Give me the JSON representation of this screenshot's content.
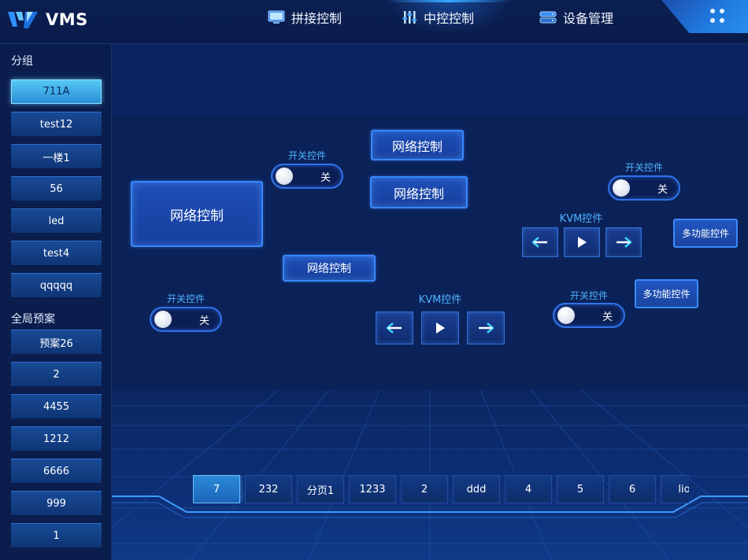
{
  "app": {
    "logo_text": "VMS"
  },
  "nav": [
    {
      "label": "拼接控制",
      "icon": "monitor-icon",
      "active": false
    },
    {
      "label": "中控控制",
      "icon": "sliders-icon",
      "active": true
    },
    {
      "label": "设备管理",
      "icon": "server-icon",
      "active": false
    }
  ],
  "sidebar": {
    "group_title": "分组",
    "groups": [
      "711A",
      "test12",
      "一楼1",
      "56",
      "led",
      "test4",
      "qqqqq"
    ],
    "active_group": "711A",
    "preset_title": "全局预案",
    "presets": [
      "预案26",
      "2",
      "4455",
      "1212",
      "6666",
      "999",
      "1"
    ]
  },
  "canvas": {
    "network_label": "网络控制",
    "switch_label": "开关控件",
    "switch_state": "关",
    "kvm_label": "KVM控件",
    "multi_label": "多功能控件"
  },
  "pages": {
    "tabs": [
      "7",
      "232",
      "分页1",
      "1233",
      "2",
      "ddd",
      "4",
      "5",
      "6",
      "lio"
    ],
    "active": "7"
  },
  "colors": {
    "accent": "#3a86ff",
    "label": "#4fb3ff",
    "active_tab": "#2a8ad8",
    "background": "#081a45"
  }
}
